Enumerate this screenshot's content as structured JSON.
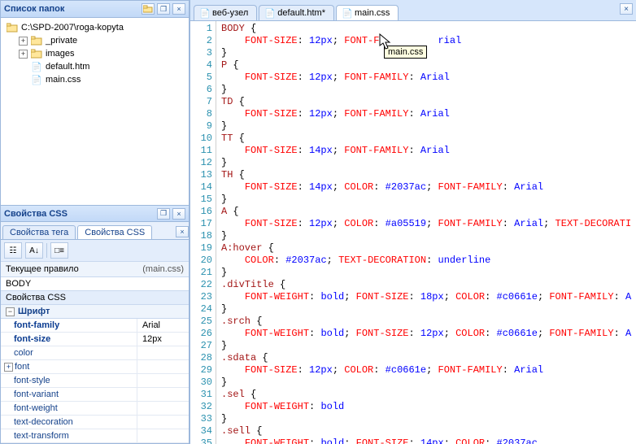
{
  "folders": {
    "title": "Список папок",
    "root": "C:\\SPD-2007\\roga-kopyta",
    "items": [
      {
        "label": "_private",
        "type": "folder",
        "expander": "+"
      },
      {
        "label": "images",
        "type": "folder",
        "expander": "+"
      },
      {
        "label": "default.htm",
        "type": "file-htm",
        "expander": ""
      },
      {
        "label": "main.css",
        "type": "file-css",
        "expander": ""
      }
    ]
  },
  "cssPanel": {
    "title": "Свойства CSS",
    "tabs": [
      "Свойства тега",
      "Свойства CSS"
    ],
    "activeTab": 1,
    "currentRule": {
      "label": "Текущее правило",
      "file": "(main.css)"
    },
    "selector": "BODY",
    "section": "Свойства CSS",
    "category": "Шрифт",
    "props": [
      {
        "name": "font-family",
        "value": "Arial",
        "bold": true
      },
      {
        "name": "font-size",
        "value": "12px",
        "bold": true
      },
      {
        "name": "color",
        "value": ""
      },
      {
        "name": "font",
        "value": "",
        "haschild": true
      },
      {
        "name": "font-style",
        "value": ""
      },
      {
        "name": "font-variant",
        "value": ""
      },
      {
        "name": "font-weight",
        "value": ""
      },
      {
        "name": "text-decoration",
        "value": ""
      },
      {
        "name": "text-transform",
        "value": ""
      }
    ]
  },
  "editor": {
    "tabs": [
      {
        "label": "веб-узел",
        "active": false
      },
      {
        "label": "default.htm*",
        "active": false
      },
      {
        "label": "main.css",
        "active": true
      }
    ],
    "tooltip": "main.css",
    "lines": [
      {
        "n": 1,
        "tokens": [
          [
            "sel",
            "BODY"
          ],
          [
            "pun",
            " {"
          ]
        ]
      },
      {
        "n": 2,
        "tokens": [
          [
            "pun",
            "    "
          ],
          [
            "prop",
            "FONT-SIZE"
          ],
          [
            "pun",
            ": "
          ],
          [
            "valc",
            "12px"
          ],
          [
            "pun",
            "; "
          ],
          [
            "prop",
            "FONT-FA"
          ],
          [
            "pun",
            "         "
          ],
          [
            "valc",
            "rial"
          ]
        ]
      },
      {
        "n": 3,
        "tokens": [
          [
            "pun",
            "}"
          ]
        ]
      },
      {
        "n": 4,
        "tokens": [
          [
            "sel",
            "P"
          ],
          [
            "pun",
            " {"
          ]
        ]
      },
      {
        "n": 5,
        "tokens": [
          [
            "pun",
            "    "
          ],
          [
            "prop",
            "FONT-SIZE"
          ],
          [
            "pun",
            ": "
          ],
          [
            "valc",
            "12px"
          ],
          [
            "pun",
            "; "
          ],
          [
            "prop",
            "FONT-FAMILY"
          ],
          [
            "pun",
            ": "
          ],
          [
            "valc",
            "Arial"
          ]
        ]
      },
      {
        "n": 6,
        "tokens": [
          [
            "pun",
            "}"
          ]
        ]
      },
      {
        "n": 7,
        "tokens": [
          [
            "sel",
            "TD"
          ],
          [
            "pun",
            " {"
          ]
        ]
      },
      {
        "n": 8,
        "tokens": [
          [
            "pun",
            "    "
          ],
          [
            "prop",
            "FONT-SIZE"
          ],
          [
            "pun",
            ": "
          ],
          [
            "valc",
            "12px"
          ],
          [
            "pun",
            "; "
          ],
          [
            "prop",
            "FONT-FAMILY"
          ],
          [
            "pun",
            ": "
          ],
          [
            "valc",
            "Arial"
          ]
        ]
      },
      {
        "n": 9,
        "tokens": [
          [
            "pun",
            "}"
          ]
        ]
      },
      {
        "n": 10,
        "tokens": [
          [
            "sel",
            "TT"
          ],
          [
            "pun",
            " {"
          ]
        ]
      },
      {
        "n": 11,
        "tokens": [
          [
            "pun",
            "    "
          ],
          [
            "prop",
            "FONT-SIZE"
          ],
          [
            "pun",
            ": "
          ],
          [
            "valc",
            "14px"
          ],
          [
            "pun",
            "; "
          ],
          [
            "prop",
            "FONT-FAMILY"
          ],
          [
            "pun",
            ": "
          ],
          [
            "valc",
            "Arial"
          ]
        ]
      },
      {
        "n": 12,
        "tokens": [
          [
            "pun",
            "}"
          ]
        ]
      },
      {
        "n": 13,
        "tokens": [
          [
            "sel",
            "TH"
          ],
          [
            "pun",
            " {"
          ]
        ]
      },
      {
        "n": 14,
        "tokens": [
          [
            "pun",
            "    "
          ],
          [
            "prop",
            "FONT-SIZE"
          ],
          [
            "pun",
            ": "
          ],
          [
            "valc",
            "14px"
          ],
          [
            "pun",
            "; "
          ],
          [
            "prop",
            "COLOR"
          ],
          [
            "pun",
            ": "
          ],
          [
            "valc",
            "#2037ac"
          ],
          [
            "pun",
            "; "
          ],
          [
            "prop",
            "FONT-FAMILY"
          ],
          [
            "pun",
            ": "
          ],
          [
            "valc",
            "Arial"
          ]
        ]
      },
      {
        "n": 15,
        "tokens": [
          [
            "pun",
            "}"
          ]
        ]
      },
      {
        "n": 16,
        "tokens": [
          [
            "sel",
            "A"
          ],
          [
            "pun",
            " {"
          ]
        ]
      },
      {
        "n": 17,
        "tokens": [
          [
            "pun",
            "    "
          ],
          [
            "prop",
            "FONT-SIZE"
          ],
          [
            "pun",
            ": "
          ],
          [
            "valc",
            "12px"
          ],
          [
            "pun",
            "; "
          ],
          [
            "prop",
            "COLOR"
          ],
          [
            "pun",
            ": "
          ],
          [
            "valc",
            "#a05519"
          ],
          [
            "pun",
            "; "
          ],
          [
            "prop",
            "FONT-FAMILY"
          ],
          [
            "pun",
            ": "
          ],
          [
            "valc",
            "Arial"
          ],
          [
            "pun",
            "; "
          ],
          [
            "prop",
            "TEXT-DECORATI"
          ]
        ]
      },
      {
        "n": 18,
        "tokens": [
          [
            "pun",
            "}"
          ]
        ]
      },
      {
        "n": 19,
        "tokens": [
          [
            "sel",
            "A:hover"
          ],
          [
            "pun",
            " {"
          ]
        ]
      },
      {
        "n": 20,
        "tokens": [
          [
            "pun",
            "    "
          ],
          [
            "prop",
            "COLOR"
          ],
          [
            "pun",
            ": "
          ],
          [
            "valc",
            "#2037ac"
          ],
          [
            "pun",
            "; "
          ],
          [
            "prop",
            "TEXT-DECORATION"
          ],
          [
            "pun",
            ": "
          ],
          [
            "valc",
            "underline"
          ]
        ]
      },
      {
        "n": 21,
        "tokens": [
          [
            "pun",
            "}"
          ]
        ]
      },
      {
        "n": 22,
        "tokens": [
          [
            "sel",
            ".divTitle"
          ],
          [
            "pun",
            " {"
          ]
        ]
      },
      {
        "n": 23,
        "tokens": [
          [
            "pun",
            "    "
          ],
          [
            "prop",
            "FONT-WEIGHT"
          ],
          [
            "pun",
            ": "
          ],
          [
            "valc",
            "bold"
          ],
          [
            "pun",
            "; "
          ],
          [
            "prop",
            "FONT-SIZE"
          ],
          [
            "pun",
            ": "
          ],
          [
            "valc",
            "18px"
          ],
          [
            "pun",
            "; "
          ],
          [
            "prop",
            "COLOR"
          ],
          [
            "pun",
            ": "
          ],
          [
            "valc",
            "#c0661e"
          ],
          [
            "pun",
            "; "
          ],
          [
            "prop",
            "FONT-FAMILY"
          ],
          [
            "pun",
            ": "
          ],
          [
            "valc",
            "A"
          ]
        ]
      },
      {
        "n": 24,
        "tokens": [
          [
            "pun",
            "}"
          ]
        ]
      },
      {
        "n": 25,
        "tokens": [
          [
            "sel",
            ".srch"
          ],
          [
            "pun",
            " {"
          ]
        ]
      },
      {
        "n": 26,
        "tokens": [
          [
            "pun",
            "    "
          ],
          [
            "prop",
            "FONT-WEIGHT"
          ],
          [
            "pun",
            ": "
          ],
          [
            "valc",
            "bold"
          ],
          [
            "pun",
            "; "
          ],
          [
            "prop",
            "FONT-SIZE"
          ],
          [
            "pun",
            ": "
          ],
          [
            "valc",
            "12px"
          ],
          [
            "pun",
            "; "
          ],
          [
            "prop",
            "COLOR"
          ],
          [
            "pun",
            ": "
          ],
          [
            "valc",
            "#c0661e"
          ],
          [
            "pun",
            "; "
          ],
          [
            "prop",
            "FONT-FAMILY"
          ],
          [
            "pun",
            ": "
          ],
          [
            "valc",
            "A"
          ]
        ]
      },
      {
        "n": 27,
        "tokens": [
          [
            "pun",
            "}"
          ]
        ]
      },
      {
        "n": 28,
        "tokens": [
          [
            "sel",
            ".sdata"
          ],
          [
            "pun",
            " {"
          ]
        ]
      },
      {
        "n": 29,
        "tokens": [
          [
            "pun",
            "    "
          ],
          [
            "prop",
            "FONT-SIZE"
          ],
          [
            "pun",
            ": "
          ],
          [
            "valc",
            "12px"
          ],
          [
            "pun",
            "; "
          ],
          [
            "prop",
            "COLOR"
          ],
          [
            "pun",
            ": "
          ],
          [
            "valc",
            "#c0661e"
          ],
          [
            "pun",
            "; "
          ],
          [
            "prop",
            "FONT-FAMILY"
          ],
          [
            "pun",
            ": "
          ],
          [
            "valc",
            "Arial"
          ]
        ]
      },
      {
        "n": 30,
        "tokens": [
          [
            "pun",
            "}"
          ]
        ]
      },
      {
        "n": 31,
        "tokens": [
          [
            "sel",
            ".sel"
          ],
          [
            "pun",
            " {"
          ]
        ]
      },
      {
        "n": 32,
        "tokens": [
          [
            "pun",
            "    "
          ],
          [
            "prop",
            "FONT-WEIGHT"
          ],
          [
            "pun",
            ": "
          ],
          [
            "valc",
            "bold"
          ]
        ]
      },
      {
        "n": 33,
        "tokens": [
          [
            "pun",
            "}"
          ]
        ]
      },
      {
        "n": 34,
        "tokens": [
          [
            "sel",
            ".sell"
          ],
          [
            "pun",
            " {"
          ]
        ]
      },
      {
        "n": 35,
        "tokens": [
          [
            "pun",
            "    "
          ],
          [
            "prop",
            "FONT-WEIGHT"
          ],
          [
            "pun",
            ": "
          ],
          [
            "valc",
            "bold"
          ],
          [
            "pun",
            "; "
          ],
          [
            "prop",
            "FONT-SIZE"
          ],
          [
            "pun",
            ": "
          ],
          [
            "valc",
            "14px"
          ],
          [
            "pun",
            "; "
          ],
          [
            "prop",
            "COLOR"
          ],
          [
            "pun",
            ": "
          ],
          [
            "valc",
            "#2037ac"
          ]
        ]
      }
    ]
  }
}
